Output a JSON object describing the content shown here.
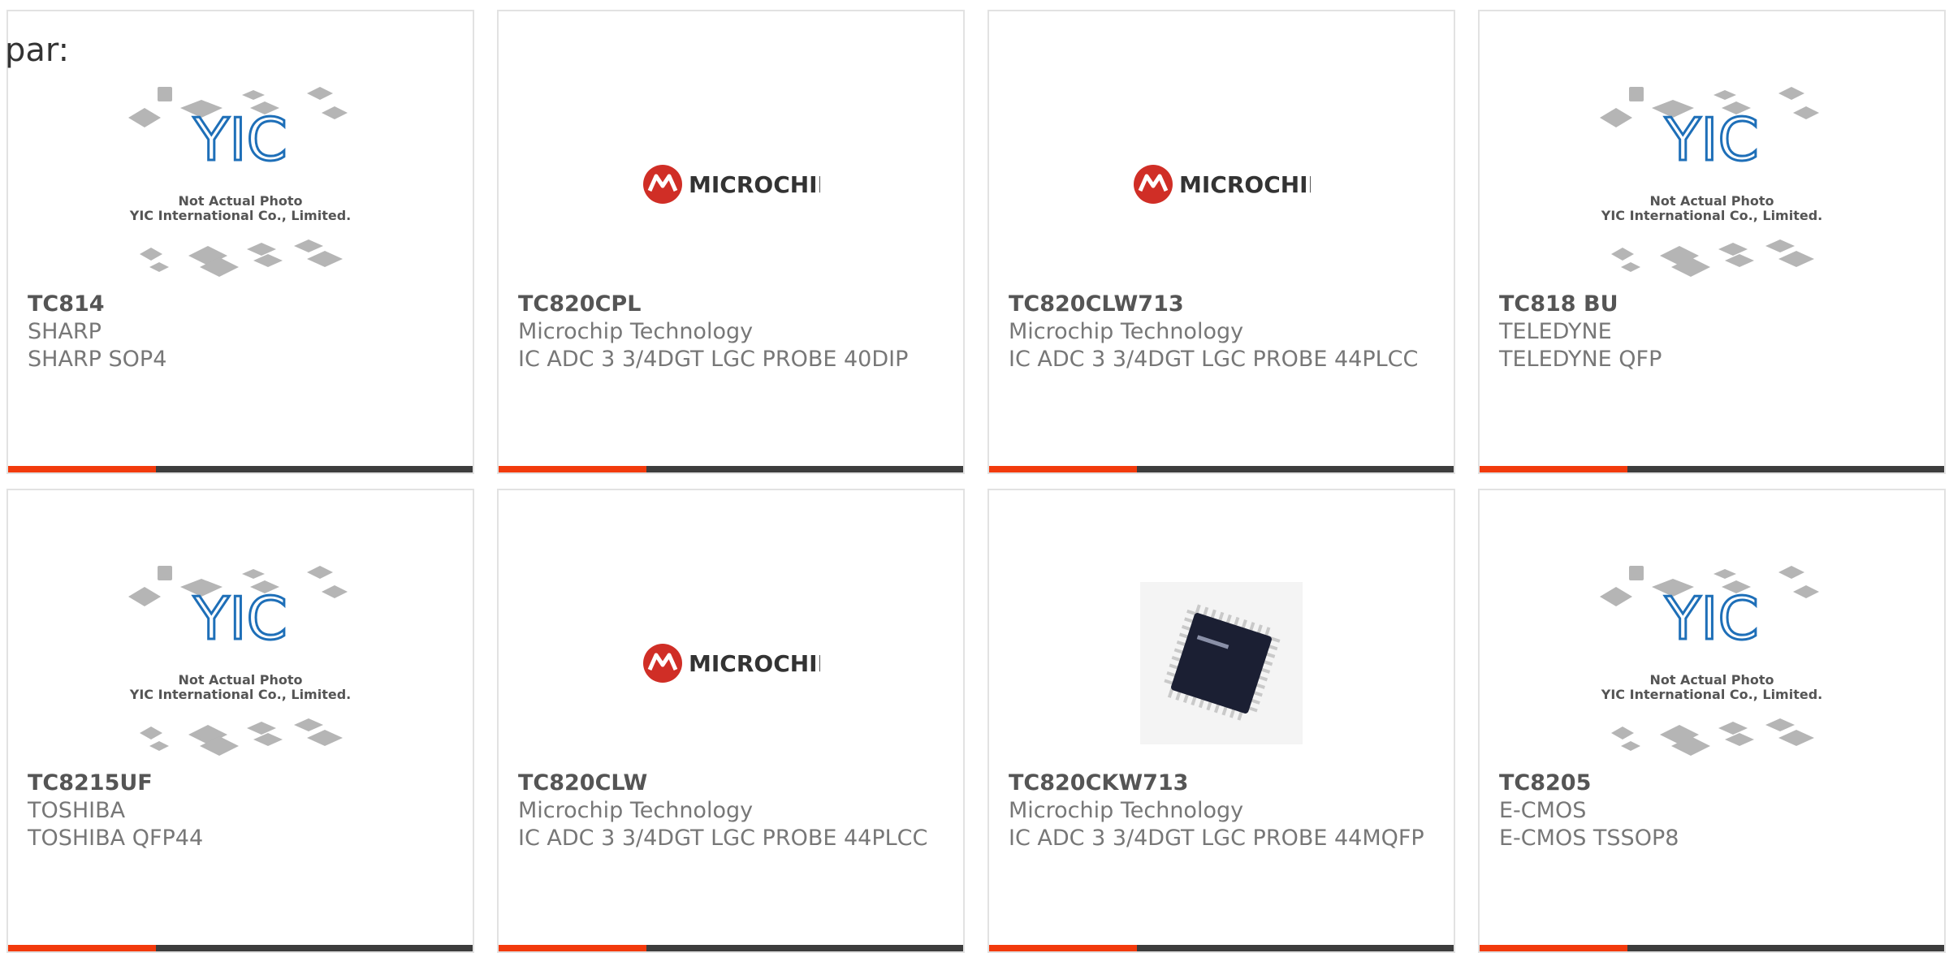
{
  "header": {
    "par_label": "par:"
  },
  "placeholder": {
    "logo_text": "YIC",
    "line1": "Not Actual Photo",
    "line2": "YIC International Co., Limited."
  },
  "brand": {
    "microchip_logo": "MICROCHIP"
  },
  "colors": {
    "accent": "#f23a0c",
    "bar": "#3d3d3d",
    "microchip_red": "#d02e26",
    "yic_blue": "#1e6fb8"
  },
  "products": [
    {
      "part": "TC814",
      "manufacturer": "SHARP",
      "description": "SHARP SOP4",
      "image": "placeholder"
    },
    {
      "part": "TC820CPL",
      "manufacturer": "Microchip Technology",
      "description": "IC ADC 3 3/4DGT LGC PROBE 40DIP",
      "image": "microchip-logo"
    },
    {
      "part": "TC820CLW713",
      "manufacturer": "Microchip Technology",
      "description": "IC ADC 3 3/4DGT LGC PROBE 44PLCC",
      "image": "microchip-logo"
    },
    {
      "part": "TC818 BU",
      "manufacturer": "TELEDYNE",
      "description": "TELEDYNE QFP",
      "image": "placeholder"
    },
    {
      "part": "TC8215UF",
      "manufacturer": "TOSHIBA",
      "description": "TOSHIBA QFP44",
      "image": "placeholder"
    },
    {
      "part": "TC820CLW",
      "manufacturer": "Microchip Technology",
      "description": "IC ADC 3 3/4DGT LGC PROBE 44PLCC",
      "image": "microchip-logo"
    },
    {
      "part": "TC820CKW713",
      "manufacturer": "Microchip Technology",
      "description": "IC ADC 3 3/4DGT LGC PROBE 44MQFP",
      "image": "chip-photo"
    },
    {
      "part": "TC8205",
      "manufacturer": "E-CMOS",
      "description": "E-CMOS TSSOP8",
      "image": "placeholder"
    }
  ]
}
